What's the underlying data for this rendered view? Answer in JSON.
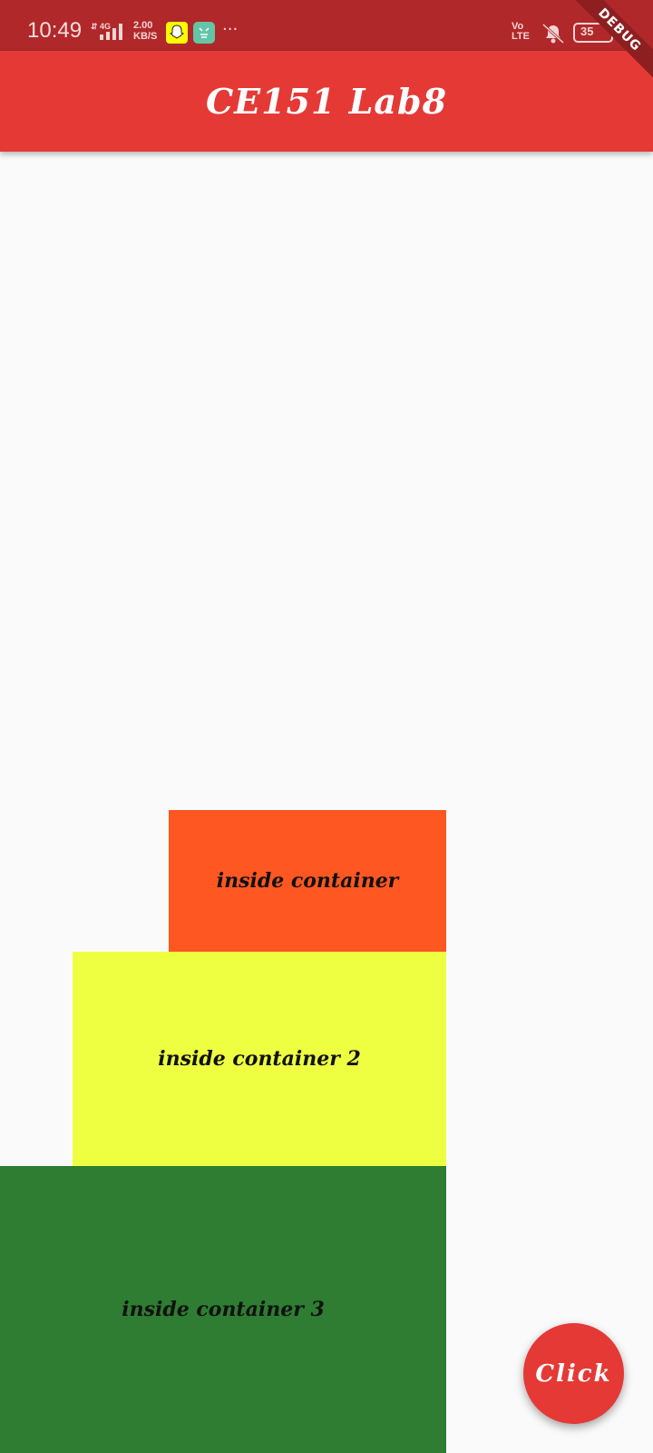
{
  "status_bar": {
    "time": "10:49",
    "network": "4G",
    "speed_value": "2.00",
    "speed_unit": "KB/S",
    "volte_top": "Vo",
    "volte_bottom": "LTE",
    "battery": "35",
    "icons": [
      "signal-icon",
      "snapchat-icon",
      "app-icon",
      "more-icon",
      "volte-icon",
      "mute-icon",
      "battery-icon",
      "charging-icon"
    ]
  },
  "app_bar": {
    "title": "CE151 Lab8",
    "color": "#e53936"
  },
  "debug_banner": "DEBUG",
  "containers": [
    {
      "label": "inside container",
      "color": "#ff5722"
    },
    {
      "label": "inside container 2",
      "color": "#eeff41"
    },
    {
      "label": "inside container 3",
      "color": "#2e7d32"
    }
  ],
  "fab": {
    "label": "Click",
    "color": "#e53936"
  }
}
